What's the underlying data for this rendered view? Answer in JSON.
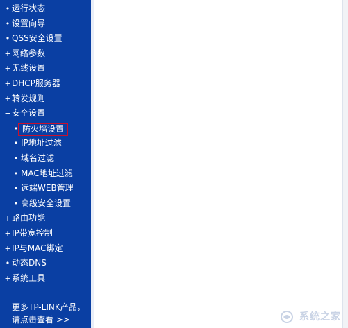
{
  "sidebar": {
    "items": [
      {
        "bullet": "•",
        "label": "运行状态"
      },
      {
        "bullet": "•",
        "label": "设置向导"
      },
      {
        "bullet": "•",
        "label": "QSS安全设置"
      },
      {
        "bullet": "+",
        "label": "网络参数"
      },
      {
        "bullet": "+",
        "label": "无线设置"
      },
      {
        "bullet": "+",
        "label": "DHCP服务器"
      },
      {
        "bullet": "+",
        "label": "转发规则"
      },
      {
        "bullet": "−",
        "label": "安全设置"
      }
    ],
    "sub_items": [
      {
        "bullet": "•",
        "label": "防火墙设置"
      },
      {
        "bullet": "•",
        "label": "IP地址过滤"
      },
      {
        "bullet": "•",
        "label": "域名过滤"
      },
      {
        "bullet": "•",
        "label": "MAC地址过滤"
      },
      {
        "bullet": "•",
        "label": "远端WEB管理"
      },
      {
        "bullet": "•",
        "label": "高级安全设置"
      }
    ],
    "items_after": [
      {
        "bullet": "+",
        "label": "路由功能"
      },
      {
        "bullet": "+",
        "label": "IP带宽控制"
      },
      {
        "bullet": "+",
        "label": "IP与MAC绑定"
      },
      {
        "bullet": "•",
        "label": "动态DNS"
      },
      {
        "bullet": "+",
        "label": "系统工具"
      }
    ],
    "promo_line1": "更多TP-LINK产品，",
    "promo_line2": "请点击查看 >>"
  },
  "watermark": {
    "text": "系统之家"
  },
  "colors": {
    "sidebar_bg": "#0a3fa3",
    "highlight_border": "#c8102e"
  }
}
